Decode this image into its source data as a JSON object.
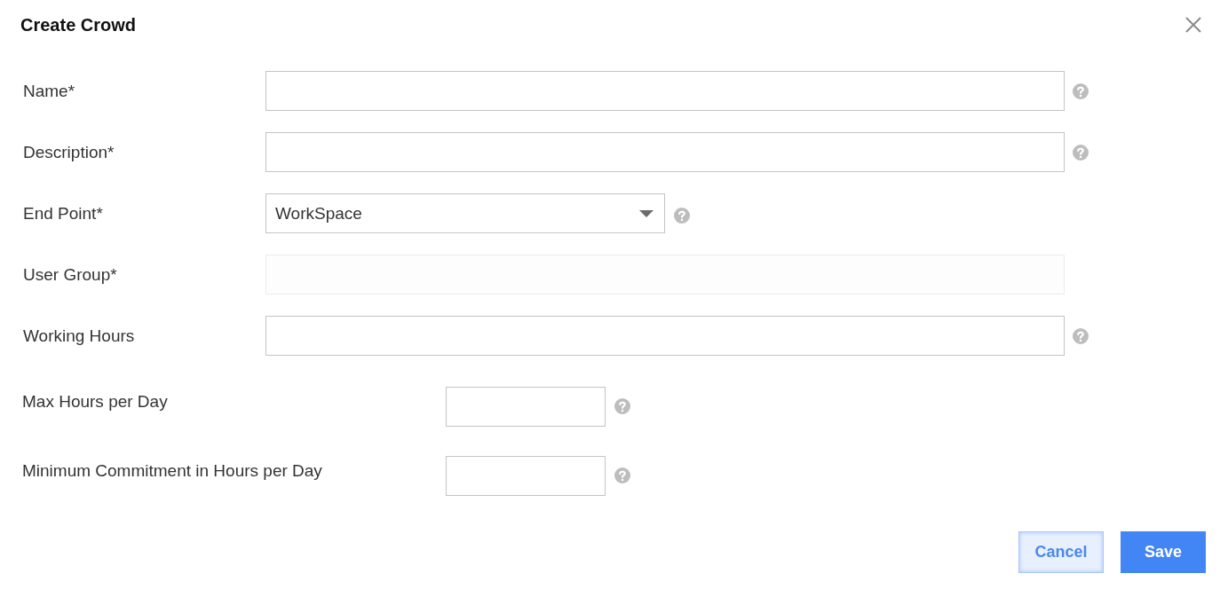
{
  "dialog": {
    "title": "Create Crowd"
  },
  "fields": [
    {
      "kind": "text",
      "label": "Name*",
      "disabled": false,
      "help": true
    },
    {
      "kind": "text",
      "label": "Description*",
      "disabled": false,
      "help": true
    },
    {
      "kind": "select",
      "label": "End Point*",
      "value": "WorkSpace",
      "disabled": false,
      "help": true
    },
    {
      "kind": "text",
      "label": "User Group*",
      "disabled": true,
      "help": false
    },
    {
      "kind": "text",
      "label": "Working Hours",
      "disabled": false,
      "help": true
    },
    {
      "kind": "number",
      "label": "Max Hours per Day",
      "disabled": false,
      "help": true
    },
    {
      "kind": "number",
      "label": "Minimum Commitment in Hours per Day",
      "disabled": false,
      "help": true
    }
  ],
  "buttons": [
    {
      "kind": "secondary",
      "label": "Cancel"
    },
    {
      "kind": "primary",
      "label": "Save"
    }
  ]
}
